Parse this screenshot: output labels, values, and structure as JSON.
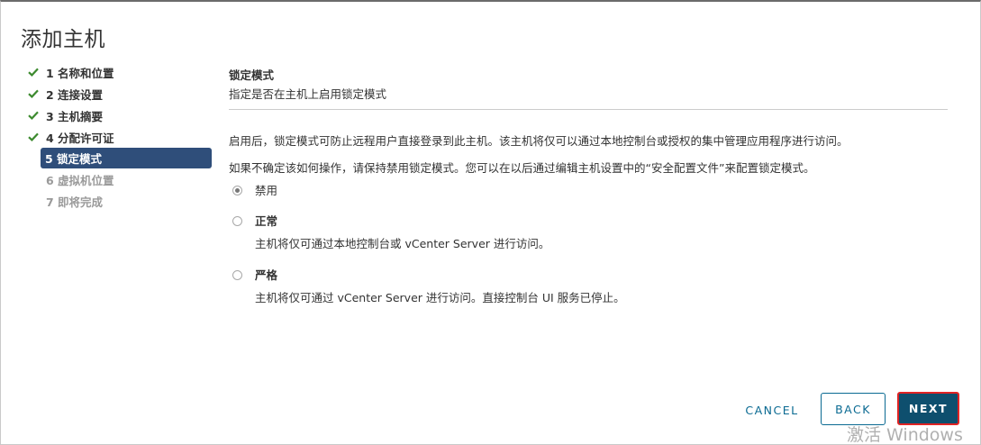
{
  "dialog": {
    "title": "添加主机"
  },
  "steps": [
    {
      "label": "1 名称和位置",
      "state": "done"
    },
    {
      "label": "2 连接设置",
      "state": "done"
    },
    {
      "label": "3 主机摘要",
      "state": "done"
    },
    {
      "label": "4 分配许可证",
      "state": "done"
    },
    {
      "label": "5 锁定模式",
      "state": "current"
    },
    {
      "label": "6 虚拟机位置",
      "state": "future"
    },
    {
      "label": "7 即将完成",
      "state": "future"
    }
  ],
  "main": {
    "heading": "锁定模式",
    "subheading": "指定是否在主机上启用锁定模式",
    "paragraph1": "启用后，锁定模式可防止远程用户直接登录到此主机。该主机将仅可以通过本地控制台或授权的集中管理应用程序进行访问。",
    "paragraph2": "如果不确定该如何操作，请保持禁用锁定模式。您可以在以后通过编辑主机设置中的“安全配置文件”来配置锁定模式。",
    "options": [
      {
        "label": "禁用",
        "description": "",
        "selected": true
      },
      {
        "label": "正常",
        "description": "主机将仅可通过本地控制台或 vCenter Server 进行访问。",
        "selected": false
      },
      {
        "label": "严格",
        "description": "主机将仅可通过 vCenter Server 进行访问。直接控制台 UI 服务已停止。",
        "selected": false
      }
    ]
  },
  "footer": {
    "cancel_label": "CANCEL",
    "back_label": "BACK",
    "next_label": "NEXT"
  },
  "watermark": "激活 Windows",
  "colors": {
    "step_active_bg": "#2f4e7a",
    "check_green": "#3c8a2e",
    "primary_button": "#0e4f6e",
    "link_blue": "#0a6a92",
    "highlight_border": "#e02424"
  }
}
